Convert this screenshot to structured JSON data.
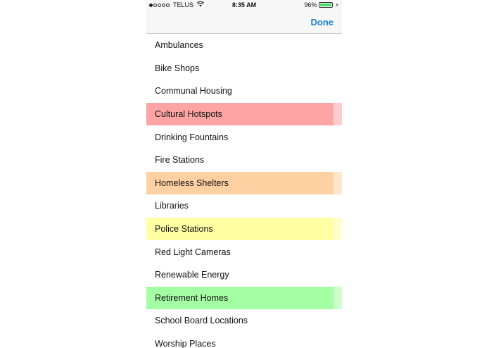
{
  "status_bar": {
    "signal_dots_filled": 1,
    "signal_dots_total": 5,
    "carrier": "TELUS",
    "wifi_icon": "wifi-icon",
    "time": "8:35 AM",
    "battery_percent": "96%",
    "battery_level": 0.96,
    "charging_icon": "bolt-icon",
    "battery_color": "#4cd964"
  },
  "nav": {
    "done_label": "Done",
    "accent_color": "#1a7fd6"
  },
  "items": [
    {
      "label": "Ambulances",
      "highlight": null
    },
    {
      "label": "Bike Shops",
      "highlight": null
    },
    {
      "label": "Communal Housing",
      "highlight": null
    },
    {
      "label": "Cultural Hotspots",
      "highlight": "#ffa4a4"
    },
    {
      "label": "Drinking Fountains",
      "highlight": null
    },
    {
      "label": "Fire Stations",
      "highlight": null
    },
    {
      "label": "Homeless Shelters",
      "highlight": "#ffd0a2"
    },
    {
      "label": "Libraries",
      "highlight": null
    },
    {
      "label": "Police Stations",
      "highlight": "#ffffa4"
    },
    {
      "label": "Red Light Cameras",
      "highlight": null
    },
    {
      "label": "Renewable Energy",
      "highlight": null
    },
    {
      "label": "Retirement Homes",
      "highlight": "#a4ffa4"
    },
    {
      "label": "School Board Locations",
      "highlight": null
    },
    {
      "label": "Worship Places",
      "highlight": null
    }
  ]
}
